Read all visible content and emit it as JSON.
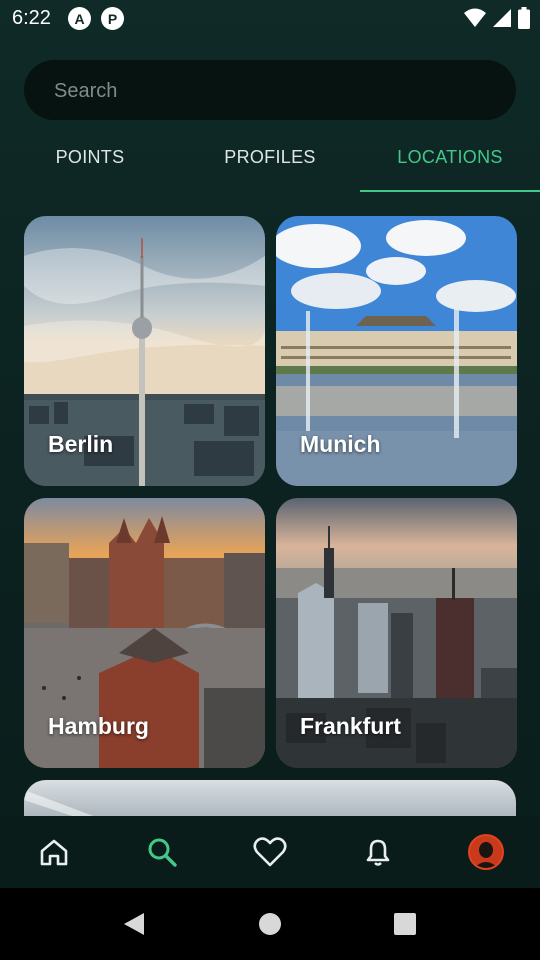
{
  "status_bar": {
    "time": "6:22",
    "app_icons": [
      "A",
      "P"
    ],
    "icons": [
      "wifi-icon",
      "signal-icon",
      "battery-icon"
    ]
  },
  "search": {
    "placeholder": "Search",
    "value": ""
  },
  "tabs": [
    {
      "label": "POINTS",
      "active": false
    },
    {
      "label": "PROFILES",
      "active": false
    },
    {
      "label": "LOCATIONS",
      "active": true
    }
  ],
  "locations": [
    {
      "name": "Berlin"
    },
    {
      "name": "Munich"
    },
    {
      "name": "Hamburg"
    },
    {
      "name": "Frankfurt"
    }
  ],
  "bottom_nav": [
    {
      "icon": "home-icon",
      "active": false
    },
    {
      "icon": "search-icon",
      "active": true
    },
    {
      "icon": "heart-icon",
      "active": false
    },
    {
      "icon": "bell-icon",
      "active": false
    },
    {
      "icon": "avatar",
      "active": false
    }
  ],
  "colors": {
    "accent": "#43c78a",
    "background": "#0c2321"
  }
}
